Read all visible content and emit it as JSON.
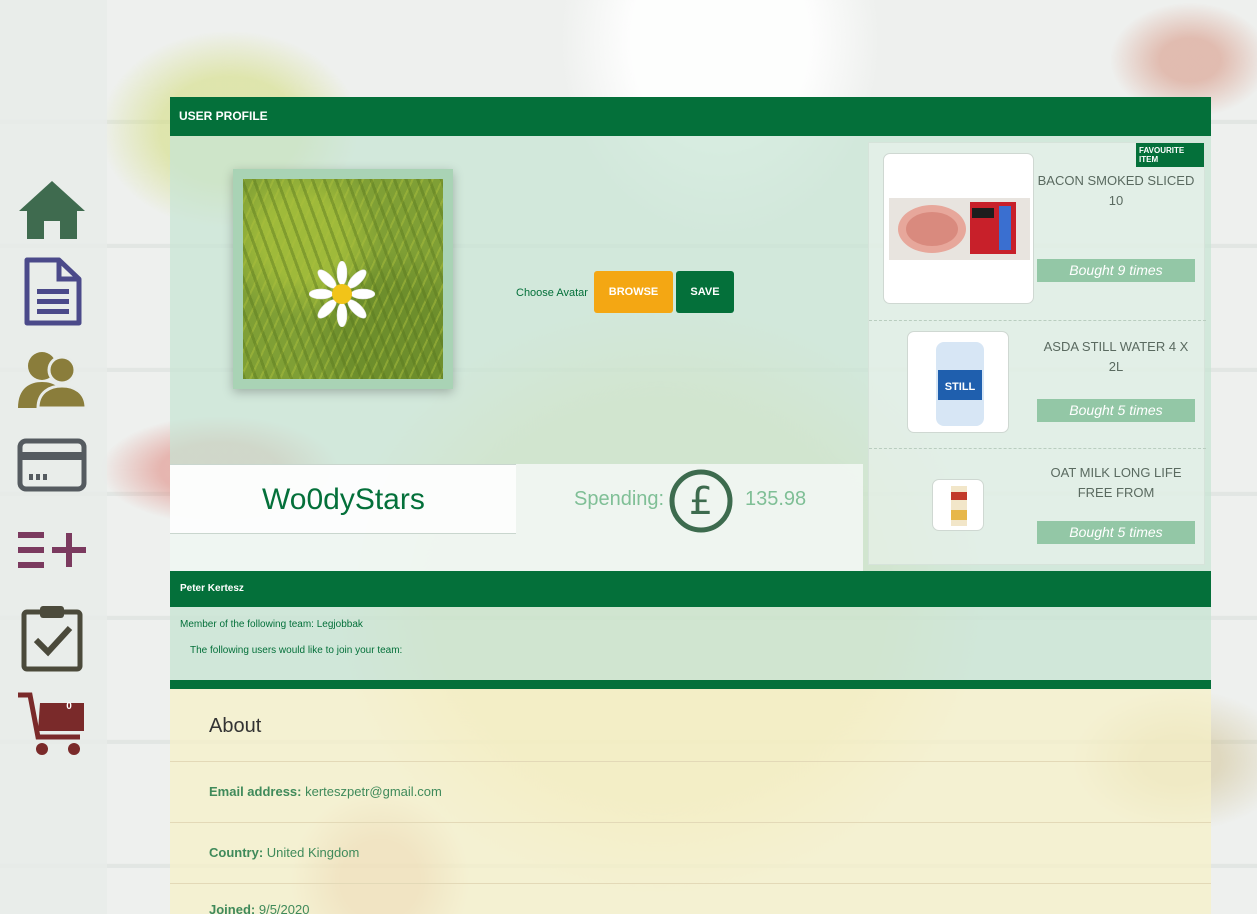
{
  "sidebar": {
    "items": [
      {
        "icon": "home-icon",
        "color": "#3f6b4f"
      },
      {
        "icon": "document-icon",
        "color": "#4b4a8a"
      },
      {
        "icon": "users-icon",
        "color": "#8a7d3b"
      },
      {
        "icon": "credit-card-icon",
        "color": "#555b60"
      },
      {
        "icon": "add-list-icon",
        "color": "#7b3a5f"
      },
      {
        "icon": "clipboard-check-icon",
        "color": "#4b4a3b"
      },
      {
        "icon": "cart-icon",
        "color": "#7a2a2a"
      }
    ],
    "cart_count": "0"
  },
  "profile": {
    "header": "USER PROFILE",
    "choose_avatar_label": "Choose Avatar",
    "browse_label": "BROWSE",
    "save_label": "SAVE",
    "username": "Wo0dyStars",
    "spending_label": "Spending:",
    "spending_value": "135.98",
    "currency_symbol": "£"
  },
  "favourites": {
    "badge": "FAVOURITE ITEM",
    "items": [
      {
        "name": "BACON SMOKED SLICED 10",
        "count": "Bought 9 times"
      },
      {
        "name": "ASDA STILL WATER 4 X 2L",
        "count": "Bought 5 times"
      },
      {
        "name": "OAT MILK LONG LIFE FREE FROM",
        "count": "Bought 5 times"
      }
    ]
  },
  "team": {
    "owner": "Peter Kertesz",
    "member_text": "Member of the following team: Legjobbak",
    "join_text": "The following users would like to join your team:"
  },
  "about": {
    "title": "About",
    "email_label": "Email address:",
    "email_value": "kerteszpetr@gmail.com",
    "country_label": "Country:",
    "country_value": "United Kingdom",
    "joined_label": "Joined:",
    "joined_value": "9/5/2020"
  },
  "colors": {
    "brand_green": "#04703a",
    "browse_orange": "#f4a713",
    "count_green": "#93c7a6"
  }
}
